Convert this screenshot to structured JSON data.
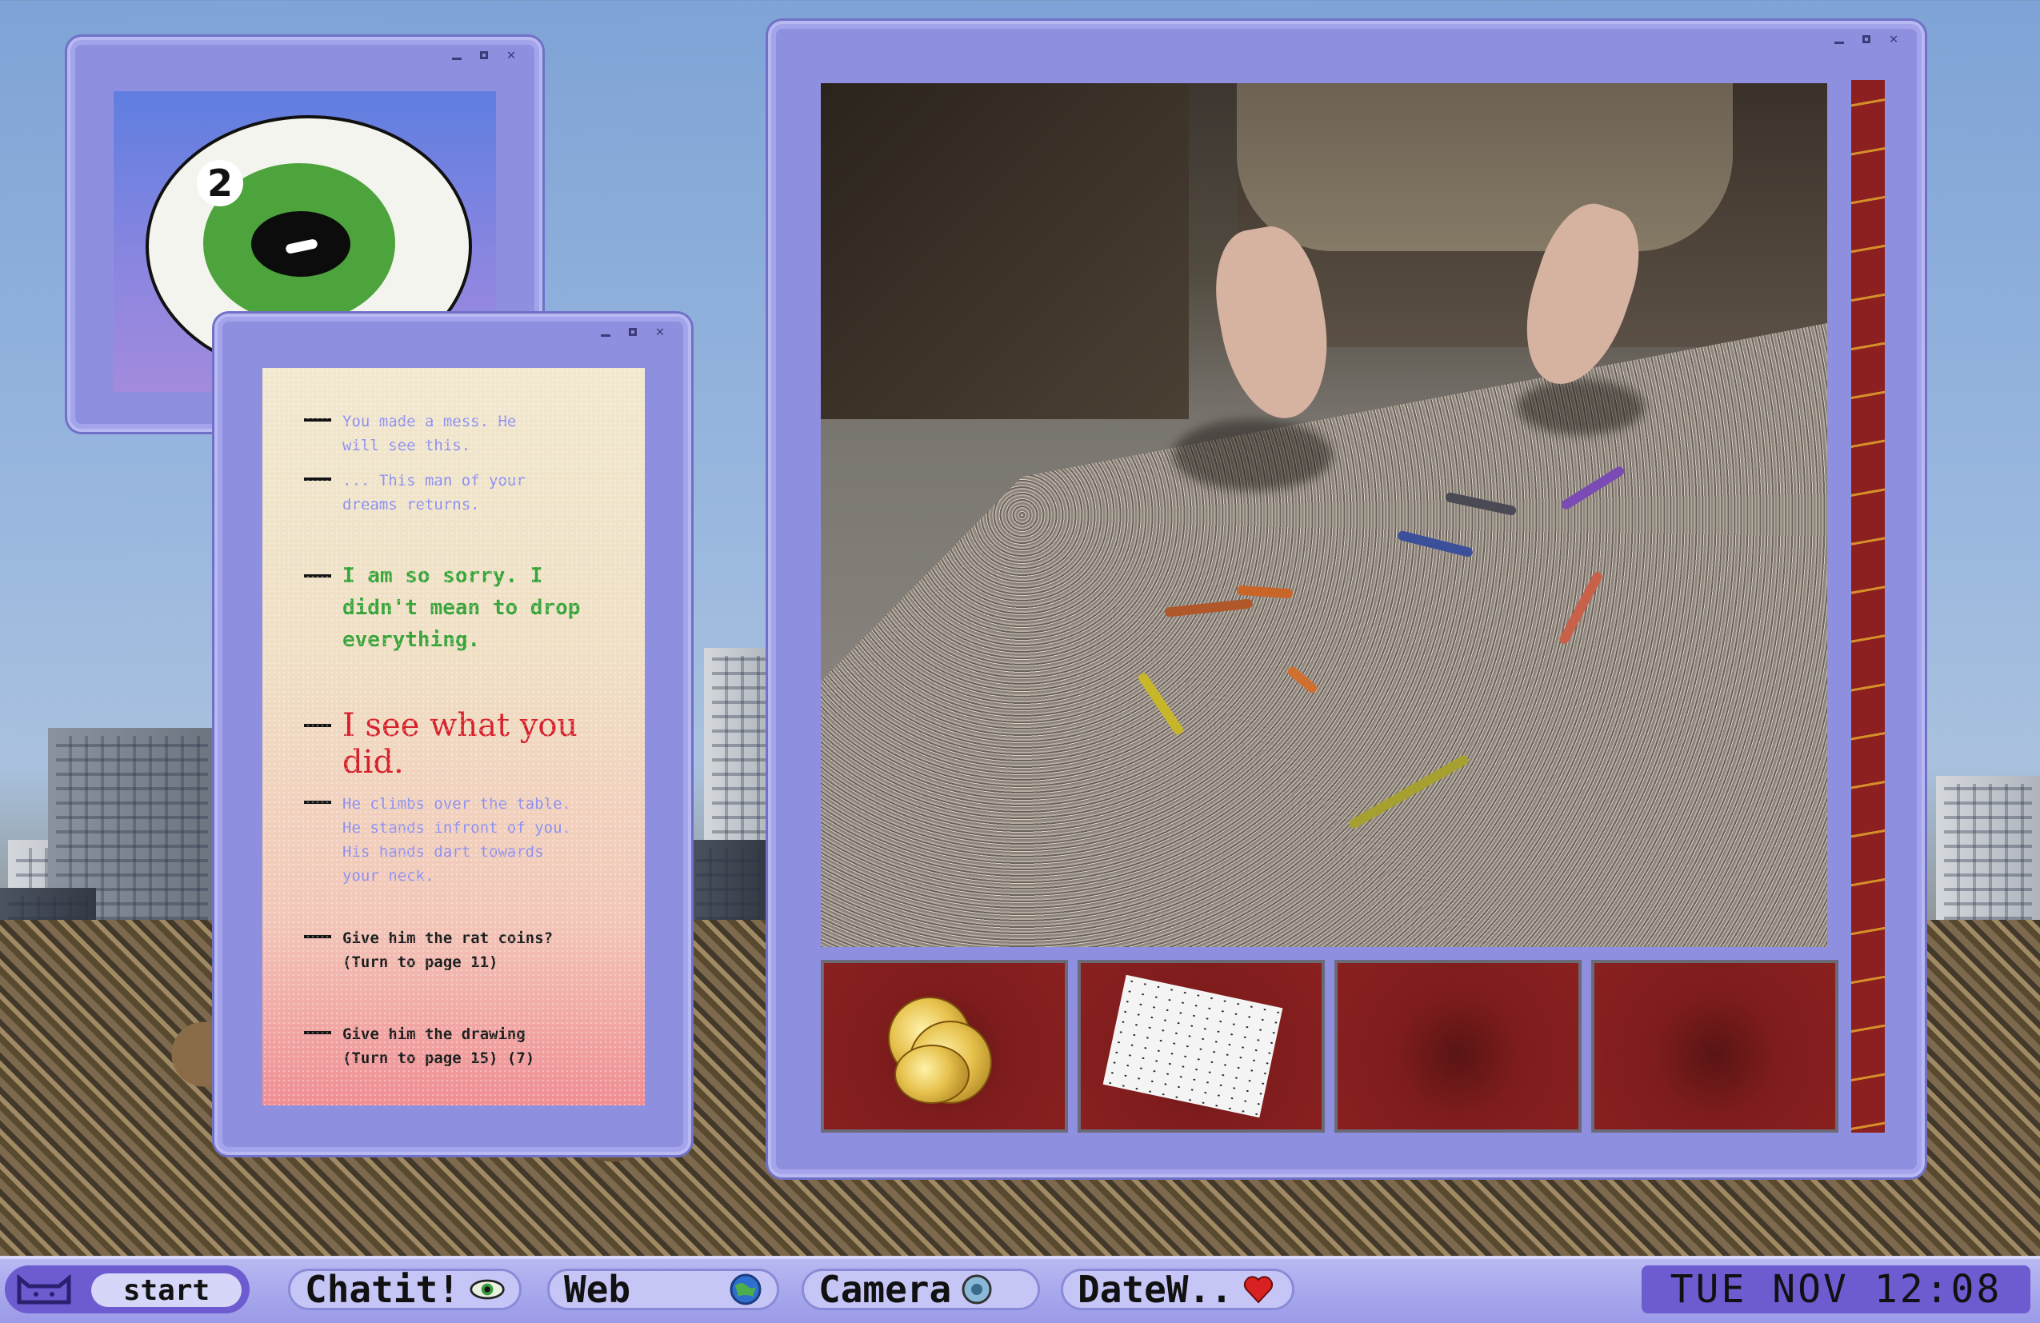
{
  "desktop": {
    "background": "city skyline"
  },
  "eye_window": {
    "badge_number": "2",
    "controls": [
      "minimize",
      "maximize",
      "close"
    ]
  },
  "story": {
    "lines": [
      {
        "text": "You made a mess. He\nwill see this.",
        "color": "#8d8ff0"
      },
      {
        "text": "... This man of your\ndreams returns.",
        "color": "#8d8ff0"
      },
      {
        "text": "I am so sorry. I\ndidn't mean to drop\neverything.",
        "color": "#39a43a"
      },
      {
        "text": "I see what you did.",
        "color": "#d6202a"
      },
      {
        "text": "He climbs over the table.\nHe stands infront of you.\nHis hands dart towards\nyour neck.",
        "color": "#8d8ff0"
      }
    ],
    "choices": [
      {
        "text": "Give him the rat coins?\n(Turn to page 11)"
      },
      {
        "text": "Give him the drawing\n(Turn to page 15) (7)"
      }
    ]
  },
  "scene_window": {
    "inventory": [
      {
        "item": "gold-coins-icon"
      },
      {
        "item": "drawing-icon"
      },
      {
        "item": "empty-slot"
      },
      {
        "item": "empty-slot"
      }
    ]
  },
  "taskbar": {
    "start_label": "start",
    "apps": [
      {
        "label": "Chatit!",
        "icon": "eye-icon"
      },
      {
        "label": "Web",
        "icon": "globe-icon"
      },
      {
        "label": "Camera",
        "icon": "lens-icon"
      },
      {
        "label": "DateW..",
        "icon": "heart-icon"
      }
    ],
    "clock": "TUE NOV 12:08"
  },
  "colors": {
    "window": "#8f8fe0",
    "window_border": "#b9b9f2",
    "inventory_red": "#8a2020",
    "taskbar": "#a6a6ec"
  }
}
